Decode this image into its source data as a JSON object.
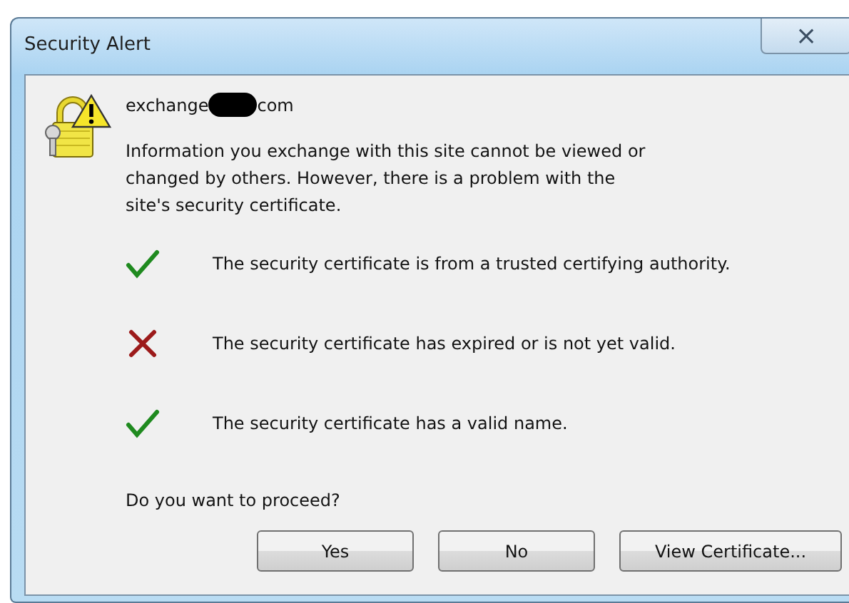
{
  "window": {
    "title": "Security Alert",
    "close_symbol": "⨯"
  },
  "site": {
    "before": "exchange",
    "after": "com"
  },
  "message": "Information you exchange with this site cannot be viewed or changed by others. However, there is a problem with the site's security certificate.",
  "checks": [
    {
      "text": "The security certificate is from a trusted certifying authority.",
      "passed": true
    },
    {
      "text": "The security certificate has expired or is not yet valid.",
      "passed": false
    },
    {
      "text": "The security certificate has a valid name.",
      "passed": true
    }
  ],
  "question": "Do you want to proceed?",
  "buttons": [
    "Yes",
    "No",
    "View Certificate..."
  ]
}
